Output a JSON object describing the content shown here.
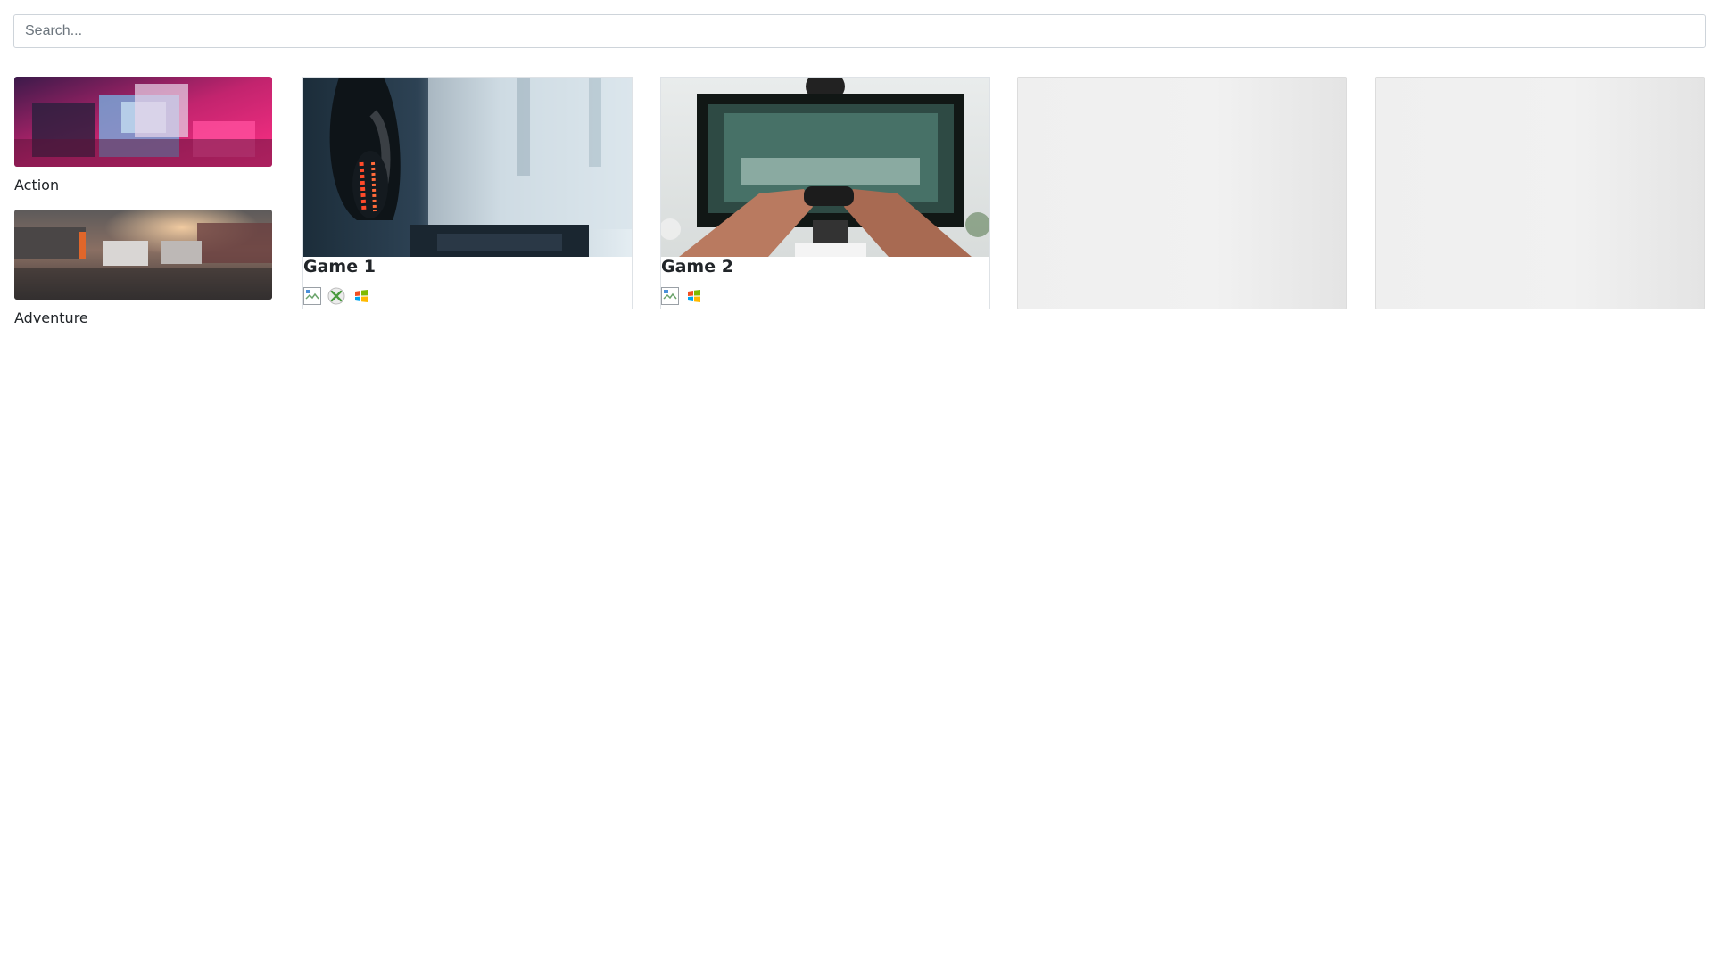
{
  "search": {
    "placeholder": "Search..."
  },
  "categories": [
    {
      "label": "Action",
      "image": "retro-consoles-photo"
    },
    {
      "label": "Adventure",
      "image": "street-cars-photo"
    }
  ],
  "games": [
    {
      "title": "Game 1",
      "image": "headset-monitor-photo",
      "platforms": [
        "broken-image-icon",
        "xbox-icon",
        "windows-icon"
      ]
    },
    {
      "title": "Game 2",
      "image": "controller-monitor-photo",
      "platforms": [
        "broken-image-icon",
        "windows-icon"
      ]
    }
  ],
  "placeholders": 2,
  "colors": {
    "border": "#dee2e6",
    "skeleton": "#efefef",
    "xbox": "#4a9a3f"
  }
}
